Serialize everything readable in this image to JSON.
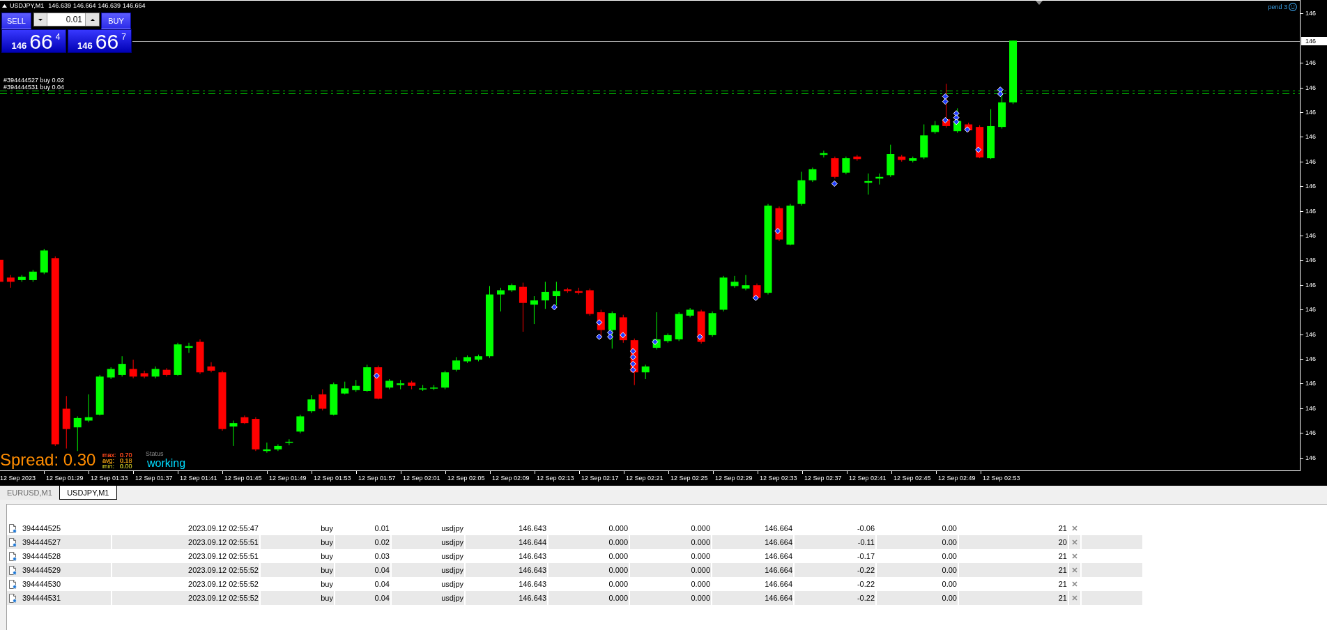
{
  "chart": {
    "title": "USDJPY,M1",
    "ohlc": [
      "146.639",
      "146.664",
      "146.639",
      "146.664"
    ],
    "trade_panel": {
      "sell": {
        "label": "SELL",
        "prefix": "146",
        "main": "66",
        "pip": "4"
      },
      "buy": {
        "label": "BUY",
        "prefix": "146",
        "main": "66",
        "pip": "7"
      },
      "lot": "0.01"
    },
    "indicator": "pend 3",
    "order_lines": [
      {
        "label": "#394444527 buy 0.02"
      },
      {
        "label": "#394444531 buy 0.04"
      }
    ],
    "spread": {
      "label": "Spread: 0.30",
      "stats": [
        {
          "label": "max:",
          "value": "0.70",
          "color": "#e0401a"
        },
        {
          "label": "avg:",
          "value": "0.18",
          "color": "#c8860f"
        },
        {
          "label": "min:",
          "value": "0.00",
          "color": "#a8a420"
        }
      ]
    },
    "status": {
      "label": "Status",
      "value": "working"
    },
    "price_axis": {
      "labels": [
        "146",
        "146",
        "146",
        "146",
        "146",
        "146",
        "146",
        "146",
        "146",
        "146",
        "146",
        "146",
        "146",
        "146",
        "146",
        "146",
        "146",
        "146"
      ],
      "current": "146"
    },
    "time_axis": [
      "12 Sep 2023",
      "12 Sep 01:29",
      "12 Sep 01:33",
      "12 Sep 01:37",
      "12 Sep 01:41",
      "12 Sep 01:45",
      "12 Sep 01:49",
      "12 Sep 01:53",
      "12 Sep 01:57",
      "12 Sep 02:01",
      "12 Sep 02:05",
      "12 Sep 02:09",
      "12 Sep 02:13",
      "12 Sep 02:17",
      "12 Sep 02:21",
      "12 Sep 02:25",
      "12 Sep 02:29",
      "12 Sep 02:33",
      "12 Sep 02:37",
      "12 Sep 02:41",
      "12 Sep 02:45",
      "12 Sep 02:49",
      "12 Sep 02:53"
    ]
  },
  "chart_tabs": [
    {
      "label": "EURUSD,M1",
      "selected": false
    },
    {
      "label": "USDJPY,M1",
      "selected": true
    }
  ],
  "orders": {
    "rows": [
      {
        "cells": [
          "394444525",
          "2023.09.12 02:55:47",
          "buy",
          "0.01",
          "usdjpy",
          "146.643",
          "0.000",
          "0.000",
          "146.664",
          "-0.06",
          "0.00",
          "21"
        ]
      },
      {
        "cells": [
          "394444527",
          "2023.09.12 02:55:51",
          "buy",
          "0.02",
          "usdjpy",
          "146.644",
          "0.000",
          "0.000",
          "146.664",
          "-0.11",
          "0.00",
          "20"
        ]
      },
      {
        "cells": [
          "394444528",
          "2023.09.12 02:55:51",
          "buy",
          "0.03",
          "usdjpy",
          "146.643",
          "0.000",
          "0.000",
          "146.664",
          "-0.17",
          "0.00",
          "21"
        ]
      },
      {
        "cells": [
          "394444529",
          "2023.09.12 02:55:52",
          "buy",
          "0.04",
          "usdjpy",
          "146.643",
          "0.000",
          "0.000",
          "146.664",
          "-0.22",
          "0.00",
          "21"
        ]
      },
      {
        "cells": [
          "394444530",
          "2023.09.12 02:55:52",
          "buy",
          "0.04",
          "usdjpy",
          "146.643",
          "0.000",
          "0.000",
          "146.664",
          "-0.22",
          "0.00",
          "21"
        ]
      },
      {
        "cells": [
          "394444531",
          "2023.09.12 02:55:52",
          "buy",
          "0.04",
          "usdjpy",
          "146.643",
          "0.000",
          "0.000",
          "146.664",
          "-0.22",
          "0.00",
          "21"
        ]
      }
    ]
  }
}
